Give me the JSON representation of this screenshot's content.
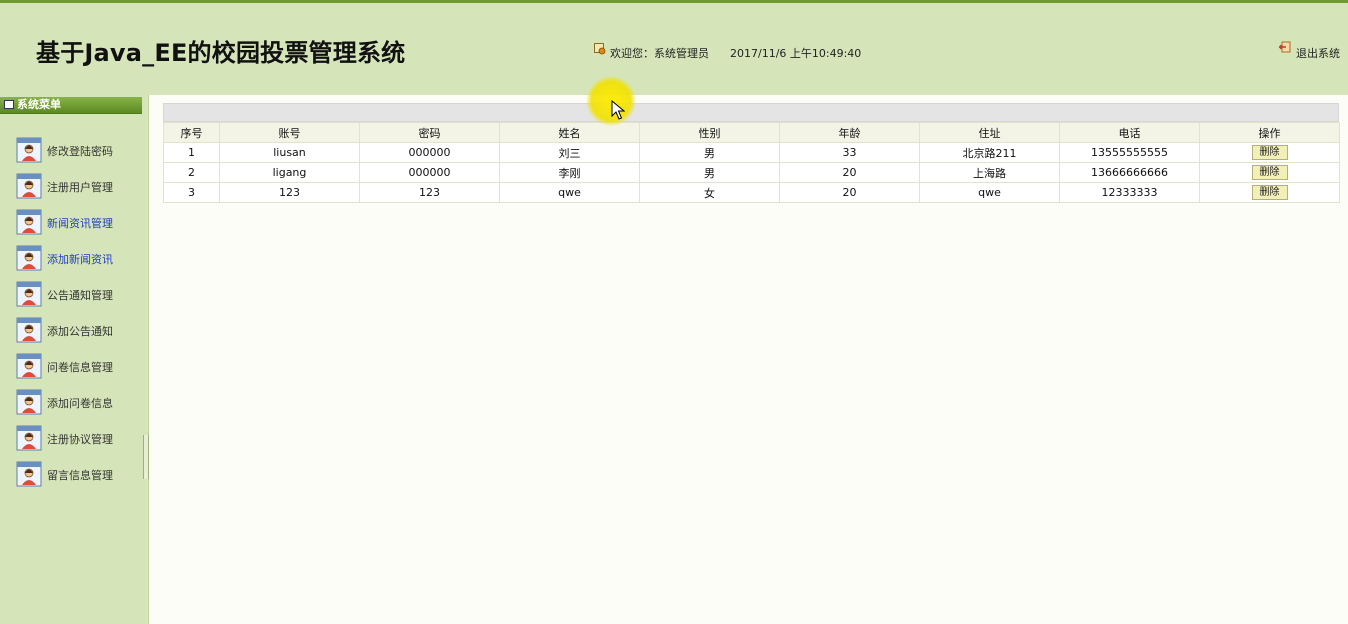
{
  "header": {
    "title": "基于Java_EE的校园投票管理系统",
    "welcome": "欢迎您：系统管理员",
    "datetime": "2017/11/6 上午10:49:40",
    "logout": "退出系统"
  },
  "sidebar": {
    "title": "系统菜单",
    "items": [
      {
        "label": "修改登陆密码",
        "icon": "user-card-icon"
      },
      {
        "label": "注册用户管理",
        "icon": "user-card-icon"
      },
      {
        "label": "新闻资讯管理",
        "icon": "user-card-icon"
      },
      {
        "label": "添加新闻资讯",
        "icon": "user-card-icon"
      },
      {
        "label": "公告通知管理",
        "icon": "user-card-icon"
      },
      {
        "label": "添加公告通知",
        "icon": "user-card-icon"
      },
      {
        "label": "问卷信息管理",
        "icon": "user-card-icon"
      },
      {
        "label": "添加问卷信息",
        "icon": "user-card-icon"
      },
      {
        "label": "注册协议管理",
        "icon": "user-card-icon"
      },
      {
        "label": "留言信息管理",
        "icon": "user-card-icon"
      }
    ]
  },
  "table": {
    "columns": [
      "序号",
      "账号",
      "密码",
      "姓名",
      "性别",
      "年龄",
      "住址",
      "电话",
      "操作"
    ],
    "rows": [
      [
        "1",
        "liusan",
        "000000",
        "刘三",
        "男",
        "33",
        "北京路211",
        "13555555555",
        "删除"
      ],
      [
        "2",
        "ligang",
        "000000",
        "李刚",
        "男",
        "20",
        "上海路",
        "13666666666",
        "删除"
      ],
      [
        "3",
        "123",
        "123",
        "qwe",
        "女",
        "20",
        "qwe",
        "12333333",
        "删除"
      ]
    ]
  },
  "colors": {
    "header_bg": "#d6e5b9",
    "menu_title_bg": "#6f9b2c",
    "link_blue": "#1f3fbf"
  }
}
